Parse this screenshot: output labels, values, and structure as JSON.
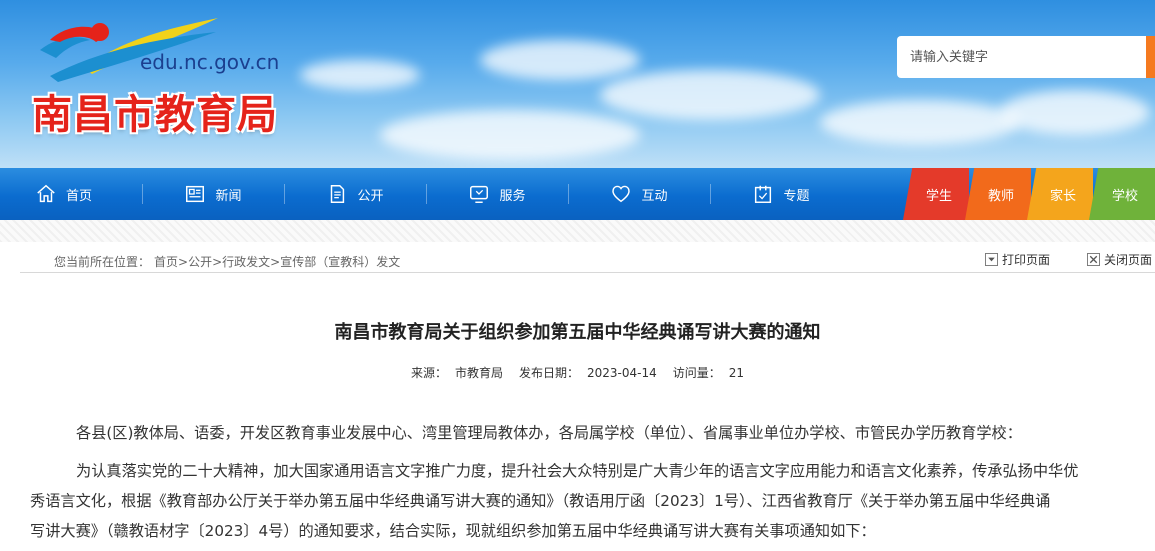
{
  "header": {
    "domain": "edu.nc.gov.cn",
    "site_title": "南昌市教育局",
    "search_placeholder": "请输入关键字"
  },
  "nav": {
    "items": [
      {
        "label": "首页",
        "icon": "home-icon"
      },
      {
        "label": "新闻",
        "icon": "news-icon"
      },
      {
        "label": "公开",
        "icon": "document-icon"
      },
      {
        "label": "服务",
        "icon": "service-icon"
      },
      {
        "label": "互动",
        "icon": "heart-chat-icon"
      },
      {
        "label": "专题",
        "icon": "topic-icon"
      }
    ],
    "user_tabs": [
      {
        "label": "学生",
        "color": "#e43a2a"
      },
      {
        "label": "教师",
        "color": "#f26a1b"
      },
      {
        "label": "家长",
        "color": "#f4a51c"
      },
      {
        "label": "学校",
        "color": "#6fb23a"
      }
    ]
  },
  "breadcrumb": {
    "label": "您当前所在位置：",
    "items": [
      "首页",
      "公开",
      "行政发文",
      "宣传部（宣教科）发文"
    ],
    "separator": ">",
    "print_label": "打印页面",
    "close_label": "关闭页面"
  },
  "article": {
    "title": "南昌市教育局关于组织参加第五届中华经典诵写讲大赛的通知",
    "source_label": "来源：",
    "source": "市教育局",
    "date_label": "发布日期：",
    "date": "2023-04-14",
    "views_label": "访问量：",
    "views": "21",
    "p1": "各县(区)教体局、语委，开发区教育事业发展中心、湾里管理局教体办，各局属学校（单位）、省属事业单位办学校、市管民办学历教育学校：",
    "p2_l1": "为认真落实党的二十大精神，加大国家通用语言文字推广力度，提升社会大众特别是广大青少年的语言文字应用能力和语言文化素养，传承弘扬中华优",
    "p2_l2": "秀语言文化，根据《教育部办公厅关于举办第五届中华经典诵写讲大赛的通知》（教语用厅函〔2023〕1号）、江西省教育厅《关于举办第五届中华经典诵",
    "p2_l3": "写讲大赛》（赣教语材字〔2023〕4号）的通知要求，结合实际，现就组织参加第五届中华经典诵写讲大赛有关事项通知如下："
  },
  "colors": {
    "nav_blue": "#0b6ccf",
    "title_red": "#e5231a",
    "search_orange": "#f57a1f"
  }
}
